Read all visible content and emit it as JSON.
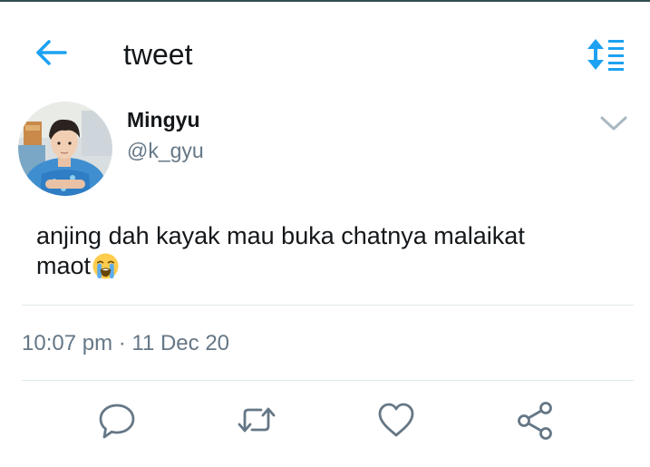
{
  "header": {
    "title": "tweet",
    "back_icon": "arrow-left-icon",
    "sort_icon": "sort-updown-icon",
    "accent_color": "#1da1f2"
  },
  "author": {
    "name": "Mingyu",
    "handle": "@k_gyu",
    "avatar_icon": "profile-photo",
    "menu_icon": "chevron-down-icon"
  },
  "tweet": {
    "text_line1": "anjing dah kayak mau buka chatnya malaikat",
    "text_line2": "maot",
    "emoji": "loudly-crying-face-emoji",
    "timestamp": "10:07 pm · 11 Dec 20"
  },
  "actions": [
    {
      "icon": "reply-icon"
    },
    {
      "icon": "retweet-icon"
    },
    {
      "icon": "like-heart-icon"
    },
    {
      "icon": "share-icon"
    }
  ],
  "colors": {
    "text": "#14171a",
    "secondary_text": "#657786",
    "divider": "#e1e8ed",
    "icon_gray": "#657786"
  }
}
